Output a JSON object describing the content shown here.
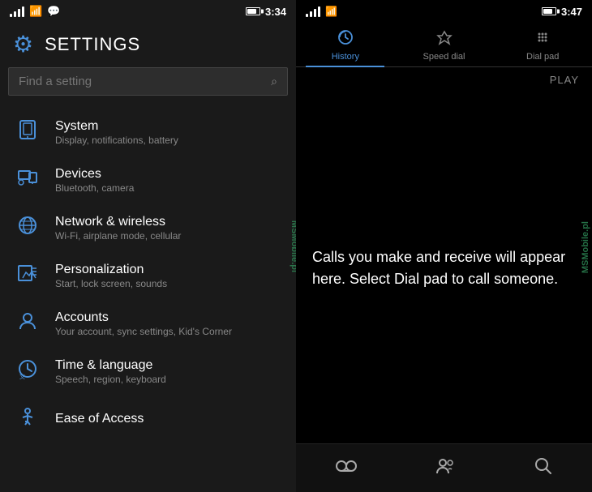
{
  "left": {
    "statusBar": {
      "time": "3:34"
    },
    "header": {
      "title": "SETTINGS"
    },
    "search": {
      "placeholder": "Find a setting"
    },
    "items": [
      {
        "id": "system",
        "icon": "📱",
        "title": "System",
        "subtitle": "Display, notifications, battery"
      },
      {
        "id": "devices",
        "icon": "🖨",
        "title": "Devices",
        "subtitle": "Bluetooth, camera"
      },
      {
        "id": "network",
        "icon": "🌐",
        "title": "Network & wireless",
        "subtitle": "Wi-Fi, airplane mode, cellular"
      },
      {
        "id": "personalization",
        "icon": "🎨",
        "title": "Personalization",
        "subtitle": "Start, lock screen, sounds"
      },
      {
        "id": "accounts",
        "icon": "👤",
        "title": "Accounts",
        "subtitle": "Your account, sync settings, Kid's Corner"
      },
      {
        "id": "time",
        "icon": "⏰",
        "title": "Time & language",
        "subtitle": "Speech, region, keyboard"
      },
      {
        "id": "ease",
        "icon": "♿",
        "title": "Ease of Access",
        "subtitle": ""
      }
    ],
    "watermark": "MSMobile.pl"
  },
  "right": {
    "statusBar": {
      "time": "3:47"
    },
    "tabs": [
      {
        "id": "history",
        "label": "History",
        "active": true
      },
      {
        "id": "speed-dial",
        "label": "Speed dial",
        "active": false
      },
      {
        "id": "dial-pad",
        "label": "Dial pad",
        "active": false
      }
    ],
    "playLabel": "PLAY",
    "callMessage": "Calls you make and receive will appear here. Select Dial pad to call someone.",
    "bottomNav": {
      "icons": [
        "voicemail",
        "contacts",
        "search"
      ]
    },
    "watermark": "MSMobile.pl"
  }
}
